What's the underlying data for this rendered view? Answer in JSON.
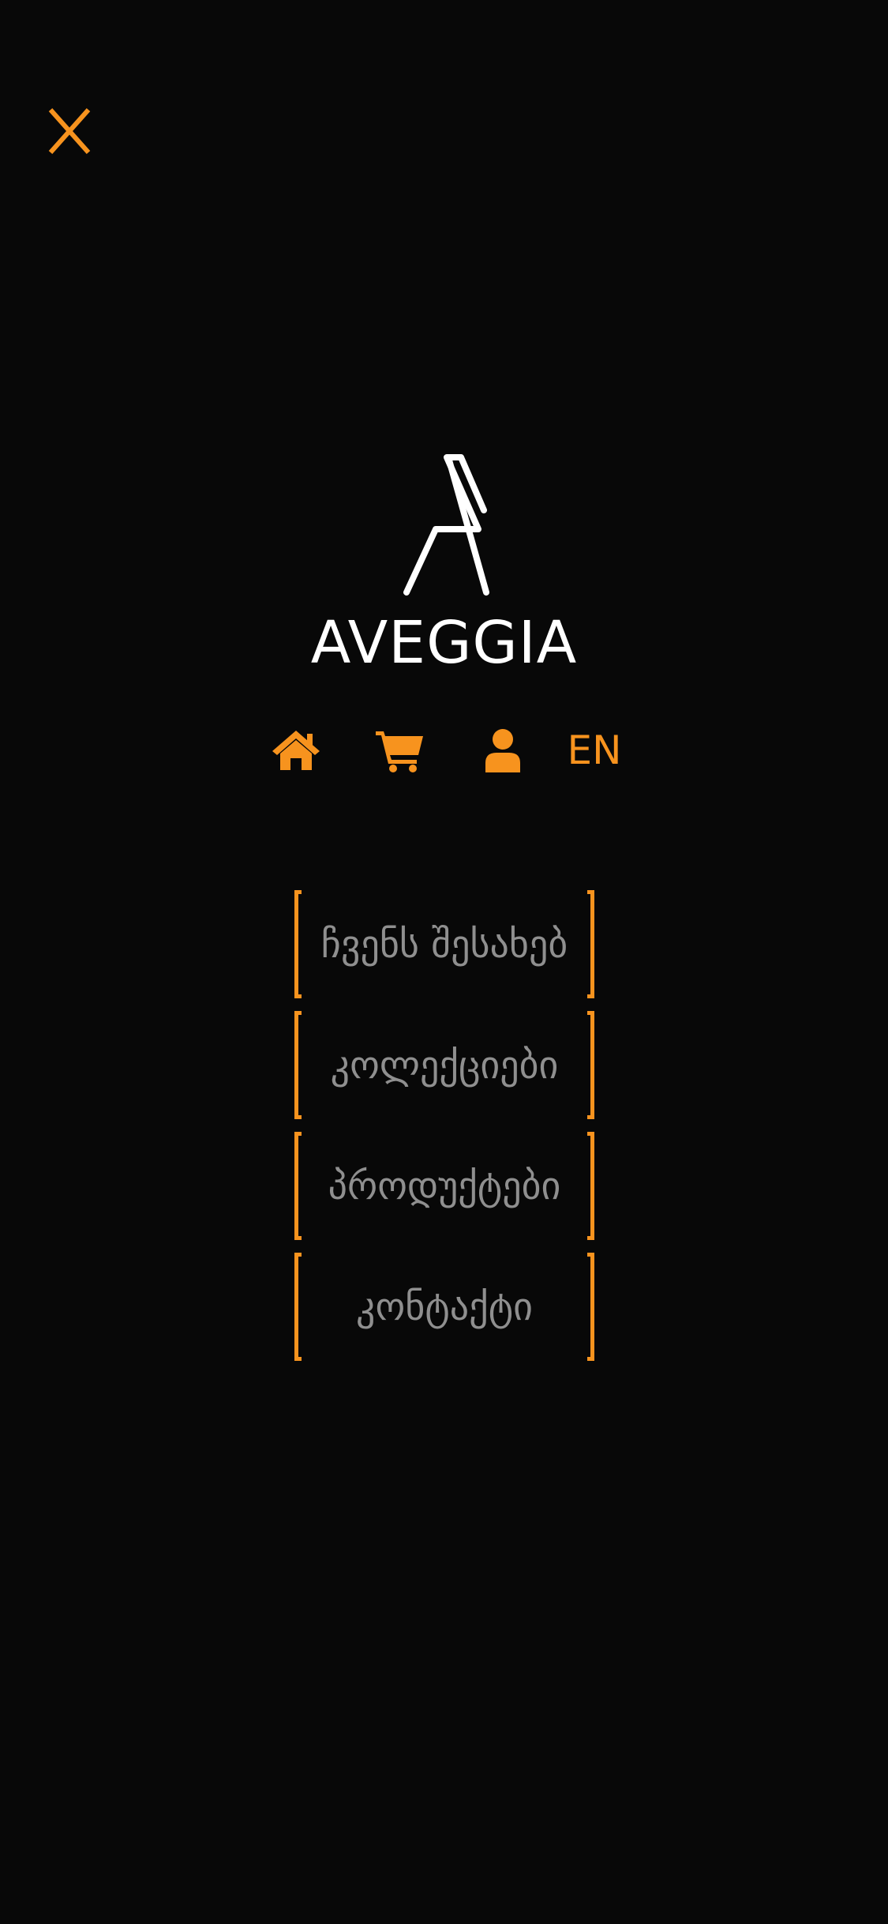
{
  "header": {
    "close_icon": "close-icon"
  },
  "brand": {
    "logo_icon": "chair-logo-icon",
    "name": "AVEGGIA"
  },
  "toolbar": {
    "home_icon": "home-icon",
    "cart_icon": "cart-icon",
    "user_icon": "user-icon",
    "language": "EN"
  },
  "menu": {
    "items": [
      {
        "label": "ჩვენს შესახებ"
      },
      {
        "label": "კოლექციები"
      },
      {
        "label": "პროდუქტები"
      },
      {
        "label": "კონტაქტი"
      }
    ]
  },
  "colors": {
    "background": "#080808",
    "accent": "#f7931e",
    "brand_text": "#ffffff",
    "menu_text": "#8f8f8f"
  }
}
